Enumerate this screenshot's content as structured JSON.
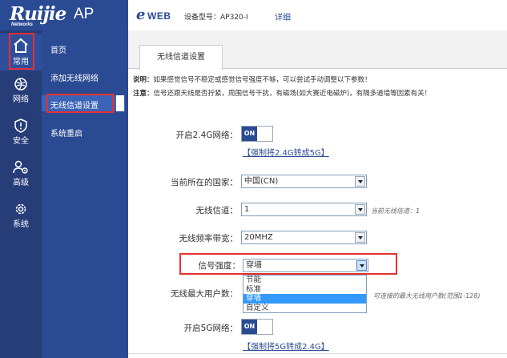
{
  "brand": {
    "logo": "Ruijie",
    "logo_sub": "Networks",
    "product": "AP",
    "eweb_e": "e",
    "eweb_rest": "WEB"
  },
  "header": {
    "model_label": "设备型号：AP320-I",
    "detail_link": "详细"
  },
  "rail": {
    "items": [
      {
        "label": "常用",
        "icon": "home-icon"
      },
      {
        "label": "网络",
        "icon": "globe-icon"
      },
      {
        "label": "安全",
        "icon": "shield-icon"
      },
      {
        "label": "高级",
        "icon": "users-gear-icon"
      },
      {
        "label": "系统",
        "icon": "gear-icon"
      }
    ]
  },
  "submenu": {
    "items": [
      {
        "label": "首页"
      },
      {
        "label": "添加无线网络"
      },
      {
        "label": "无线信道设置"
      },
      {
        "label": "系统重启"
      }
    ],
    "active_index": 2
  },
  "tab": {
    "label": "无线信道设置"
  },
  "notice": {
    "line1_bold": "说明：",
    "line1": "如果感觉信号不稳定或感觉信号强度不够，可以尝试手动调整以下参数！",
    "line2_bold": "注意：",
    "line2": "信号还跟天线是否拧紧，周围信号干扰，有磁场(如大赛近电磁炉)，有隔多道墙等因素有关！"
  },
  "form": {
    "enable_24g": {
      "label": "开启2.4G网络：",
      "value": "ON",
      "link": "【强制将2.4G转成5G】"
    },
    "country": {
      "label": "当前所在的国家：",
      "value": "中国(CN)"
    },
    "channel": {
      "label": "无线信道：",
      "value": "1",
      "hint": "当前无线信道：1"
    },
    "bandwidth": {
      "label": "无线频率带宽：",
      "value": "20MHZ"
    },
    "strength": {
      "label": "信号强度：",
      "value": "穿墙",
      "options": [
        "节能",
        "标准",
        "穿墙",
        "自定义"
      ],
      "selected_index": 2
    },
    "max_users": {
      "label": "无线最大用户数：",
      "hint": "可连接的最大无线用户数(范围1-128)"
    },
    "enable_5g": {
      "label": "开启5G网络：",
      "value": "ON",
      "link": "【强制将5G转成2.4G】"
    }
  },
  "colors": {
    "nav_dark": "#263d78",
    "nav": "#2a4a93",
    "nav_active": "#3b63b8",
    "highlight": "#e62f2f",
    "select_option": "#3399ff"
  }
}
